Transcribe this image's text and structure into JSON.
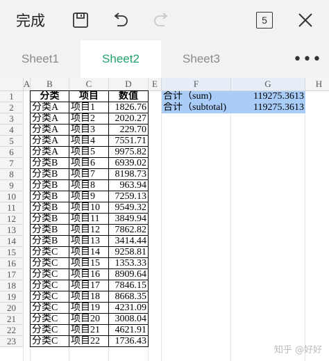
{
  "toolbar": {
    "done_label": "完成",
    "save_icon": "save-icon",
    "undo_icon": "undo-icon",
    "redo_icon": "redo-icon",
    "sheet_count": "5",
    "close_icon": "close-icon"
  },
  "sheets": {
    "tabs": [
      "Sheet1",
      "Sheet2",
      "Sheet3"
    ],
    "active_index": 1,
    "more_label": "•••"
  },
  "columns": [
    "A",
    "B",
    "C",
    "D",
    "E",
    "F",
    "G",
    "H"
  ],
  "table": {
    "headers": [
      "分类",
      "项目",
      "数值"
    ],
    "rows": [
      [
        "分类A",
        "项目1",
        "1826.76"
      ],
      [
        "分类A",
        "项目2",
        "2020.27"
      ],
      [
        "分类A",
        "项目3",
        "229.70"
      ],
      [
        "分类A",
        "项目4",
        "7551.71"
      ],
      [
        "分类A",
        "项目5",
        "9975.82"
      ],
      [
        "分类B",
        "项目6",
        "6939.02"
      ],
      [
        "分类B",
        "项目7",
        "8198.73"
      ],
      [
        "分类B",
        "项目8",
        "963.94"
      ],
      [
        "分类B",
        "项目9",
        "7259.13"
      ],
      [
        "分类B",
        "项目10",
        "9549.32"
      ],
      [
        "分类B",
        "项目11",
        "3849.94"
      ],
      [
        "分类B",
        "项目12",
        "7862.82"
      ],
      [
        "分类B",
        "项目13",
        "3414.44"
      ],
      [
        "分类C",
        "项目14",
        "9258.81"
      ],
      [
        "分类C",
        "项目15",
        "1353.33"
      ],
      [
        "分类C",
        "项目16",
        "8909.64"
      ],
      [
        "分类C",
        "项目17",
        "7846.15"
      ],
      [
        "分类C",
        "项目18",
        "8668.35"
      ],
      [
        "分类C",
        "项目19",
        "4231.09"
      ],
      [
        "分类C",
        "项目20",
        "3008.04"
      ],
      [
        "分类C",
        "项目21",
        "4621.91"
      ],
      [
        "分类C",
        "项目22",
        "1736.43"
      ]
    ]
  },
  "summary": [
    {
      "label": "合计（sum)",
      "value": "119275.3613"
    },
    {
      "label": "合计（subtotal)",
      "value": "119275.3613"
    }
  ],
  "colors": {
    "active_tab_text": "#1fa36b",
    "highlight": "#a9cdf8"
  },
  "watermark": "知乎 @好好"
}
